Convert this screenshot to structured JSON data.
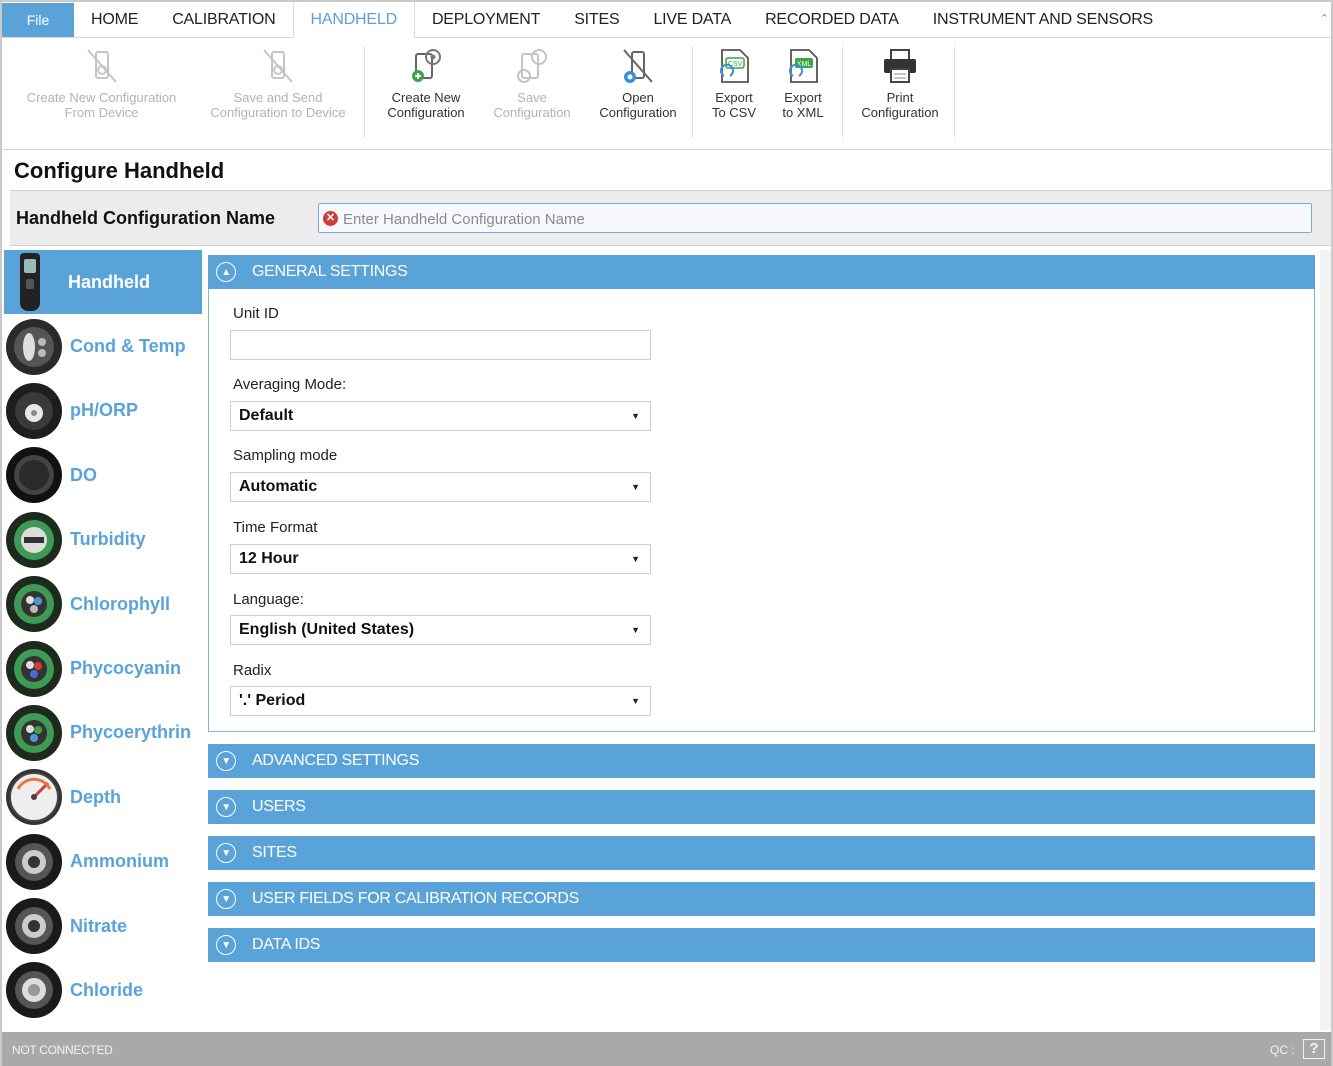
{
  "menu": {
    "file": "File",
    "items": [
      "HOME",
      "CALIBRATION",
      "HANDHELD",
      "DEPLOYMENT",
      "SITES",
      "LIVE DATA",
      "RECORDED DATA",
      "INSTRUMENT AND SENSORS"
    ],
    "active": "HANDHELD"
  },
  "ribbon": {
    "create_from_device": [
      "Create New Configuration",
      "From Device"
    ],
    "save_send": [
      "Save and Send",
      "Configuration to Device"
    ],
    "create_new": [
      "Create New",
      "Configuration"
    ],
    "save": [
      "Save",
      "Configuration"
    ],
    "open": [
      "Open",
      "Configuration"
    ],
    "export_csv": [
      "Export",
      "To CSV"
    ],
    "export_xml": [
      "Export",
      "to XML"
    ],
    "print": [
      "Print",
      "Configuration"
    ],
    "csv_badge": "CSV",
    "xml_badge": "XML"
  },
  "page_title": "Configure Handheld",
  "config_name": {
    "label": "Handheld Configuration Name",
    "placeholder": "Enter Handheld Configuration Name",
    "error_glyph": "✕"
  },
  "sidebar": {
    "items": [
      {
        "label": "Handheld",
        "active": true
      },
      {
        "label": "Cond & Temp"
      },
      {
        "label": "pH/ORP"
      },
      {
        "label": "DO"
      },
      {
        "label": "Turbidity"
      },
      {
        "label": "Chlorophyll"
      },
      {
        "label": "Phycocyanin"
      },
      {
        "label": "Phycoerythrin"
      },
      {
        "label": "Depth"
      },
      {
        "label": "Ammonium"
      },
      {
        "label": "Nitrate"
      },
      {
        "label": "Chloride"
      }
    ]
  },
  "general": {
    "title": "GENERAL SETTINGS",
    "unit_id_label": "Unit ID",
    "unit_id_value": "",
    "averaging_label": "Averaging Mode:",
    "averaging_value": "Default",
    "sampling_label": "Sampling mode",
    "sampling_value": "Automatic",
    "time_format_label": "Time Format",
    "time_format_value": "12 Hour",
    "language_label": "Language:",
    "language_value": "English (United States)",
    "radix_label": "Radix",
    "radix_value": "'.' Period"
  },
  "sections": {
    "advanced": "ADVANCED SETTINGS",
    "users": "USERS",
    "sites": "SITES",
    "user_fields": "USER FIELDS FOR CALIBRATION RECORDS",
    "data_ids": "DATA IDS"
  },
  "status": {
    "connection": "NOT CONNECTED",
    "qc": "QC :",
    "help": "?"
  },
  "colors": {
    "accent": "#5aa3d9",
    "status_bar": "#a9a9a9",
    "error": "#d23b3b"
  }
}
